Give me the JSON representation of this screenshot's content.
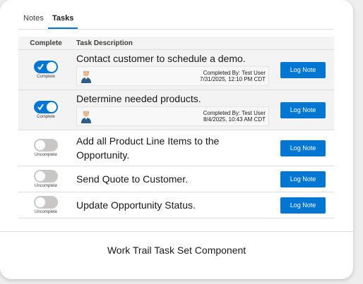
{
  "tabs": [
    {
      "label": "Notes",
      "active": false
    },
    {
      "label": "Tasks",
      "active": true
    }
  ],
  "table": {
    "columns": [
      "Complete",
      "Task Description"
    ]
  },
  "tasks": [
    {
      "description": "Contact customer to schedule a demo.",
      "complete": true,
      "toggle_label": "Complete",
      "completed_by": "Completed By: Test User",
      "completed_at": "7/31/2025, 12:10 PM CDT",
      "button_label": "Log Note"
    },
    {
      "description": "Determine needed products.",
      "complete": true,
      "toggle_label": "Complete",
      "completed_by": "Completed By: Test User",
      "completed_at": "8/4/2025, 10:43 AM CDT",
      "button_label": "Log Note"
    },
    {
      "description": "Add all Product Line Items to the Opportunity.",
      "complete": false,
      "toggle_label": "Uncomplete",
      "button_label": "Log Note"
    },
    {
      "description": "Send Quote to Customer.",
      "complete": false,
      "toggle_label": "Uncomplete",
      "button_label": "Log Note"
    },
    {
      "description": "Update Opportunity Status.",
      "complete": false,
      "toggle_label": "Uncomplete",
      "button_label": "Log Note"
    }
  ],
  "footer": {
    "caption": "Work Trail Task Set Component"
  },
  "icons": {
    "avatar": "user-avatar-icon",
    "check": "checkmark-icon"
  },
  "colors": {
    "accent": "#0176d3",
    "toggle_off": "#c9c7c5",
    "row_completed": "#f3f3f3"
  }
}
